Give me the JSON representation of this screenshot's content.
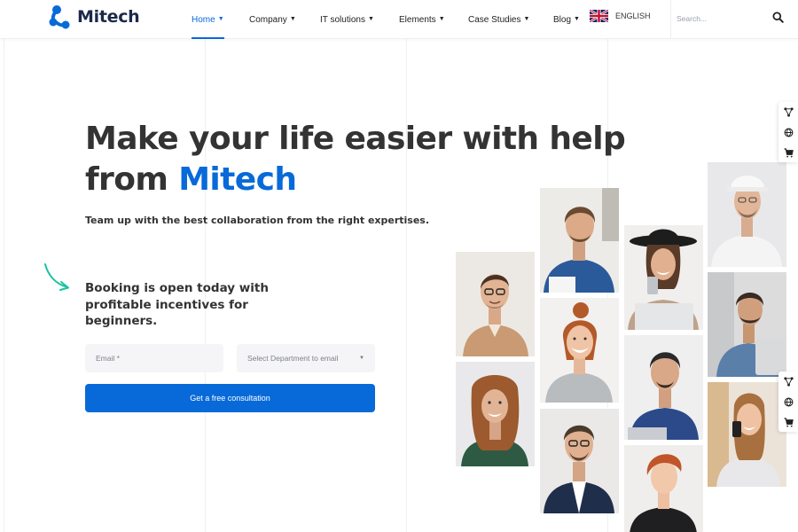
{
  "brand": {
    "name": "Mitech",
    "accent_color": "#086ad8",
    "logo_icon": "molecule-logo-icon"
  },
  "nav": {
    "items": [
      {
        "label": "Home",
        "active": true
      },
      {
        "label": "Company",
        "active": false
      },
      {
        "label": "IT solutions",
        "active": false
      },
      {
        "label": "Elements",
        "active": false
      },
      {
        "label": "Case Studies",
        "active": false
      },
      {
        "label": "Blog",
        "active": false
      }
    ],
    "language": {
      "label": "ENGLISH",
      "flag_icon": "uk-flag-icon"
    },
    "search": {
      "placeholder": "Search...",
      "icon": "search-icon"
    }
  },
  "hero": {
    "title_line1": "Make your life easier with help",
    "title_line2_prefix": "from ",
    "title_accent": "Mitech",
    "subtitle": "Team up with the best collaboration from the right expertises.",
    "booking_text": "Booking is open today with profitable incentives for beginners."
  },
  "form": {
    "email_placeholder": "Email *",
    "department_placeholder": "Select Department to email",
    "submit_label": "Get a free consultation"
  },
  "side_tools": [
    "share-icon",
    "globe-icon",
    "cart-icon"
  ]
}
